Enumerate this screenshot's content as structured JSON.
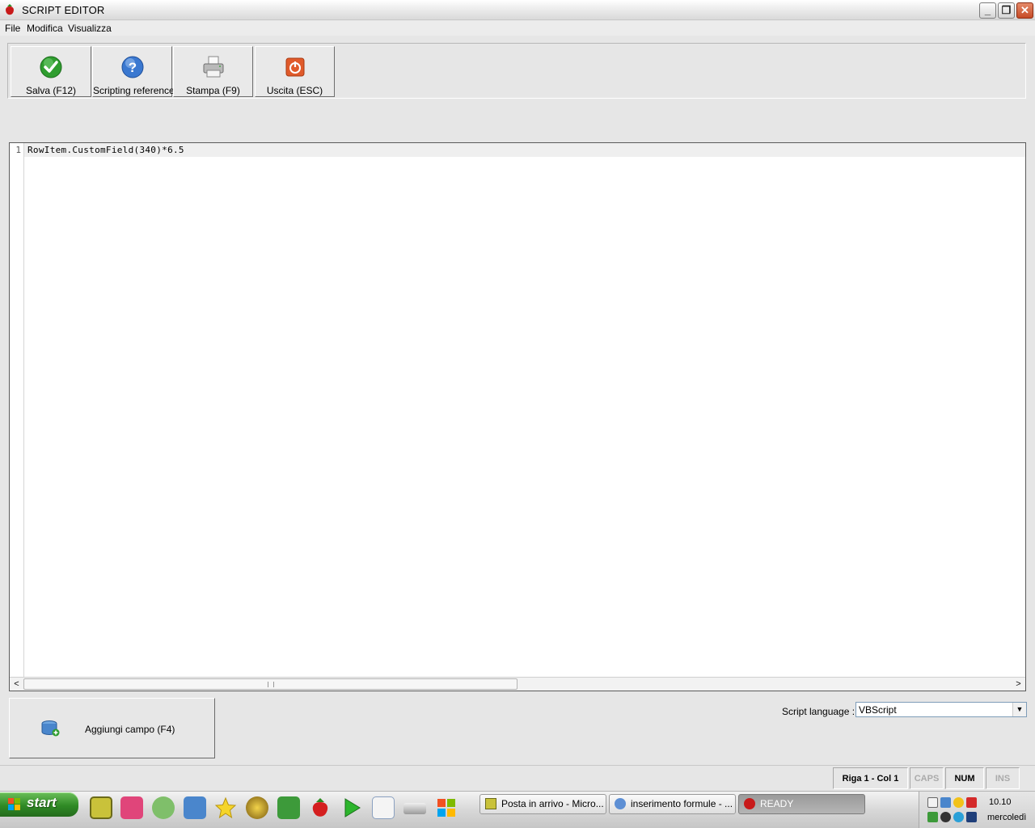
{
  "window": {
    "title": "SCRIPT EDITOR",
    "min": "_",
    "max": "❐",
    "close": "✕"
  },
  "menu": {
    "items": [
      "File",
      "Modifica",
      "Visualizza"
    ]
  },
  "toolbar": {
    "buttons": [
      {
        "label": "Salva (F12)",
        "icon": "save-check-icon"
      },
      {
        "label": "Scripting reference",
        "icon": "help-icon"
      },
      {
        "label": "Stampa (F9)",
        "icon": "printer-icon"
      },
      {
        "label": "Uscita (ESC)",
        "icon": "power-icon"
      }
    ]
  },
  "editor": {
    "line_number": "1",
    "code": "RowItem.CustomField(340)*6.5",
    "scroll_left": "<",
    "scroll_right": ">"
  },
  "add_field": {
    "label": "Aggiungi campo (F4)",
    "icon": "database-add-icon"
  },
  "script_language": {
    "label": "Script language :",
    "value": "VBScript"
  },
  "status": {
    "position": "Riga 1 - Col 1",
    "caps": "CAPS",
    "num": "NUM",
    "ins": "INS"
  },
  "taskbar": {
    "start": "start",
    "quick_launch": [
      "outlook-icon",
      "grid-icon",
      "wheel-icon",
      "refresh-icon",
      "star-icon",
      "button-icon",
      "house-icon",
      "strawberry-icon",
      "play-icon",
      "spreadsheet-icon",
      "drive-icon",
      "windows-icon"
    ],
    "tasks": [
      {
        "label": "Posta in arrivo - Micro...",
        "icon": "outlook-icon"
      },
      {
        "label": "inserimento formule - ...",
        "icon": "browser-icon"
      },
      {
        "label": "READY",
        "icon": "strawberry-icon",
        "active": true
      }
    ],
    "clock": "10.10",
    "day": "mercoledì"
  },
  "colors": {
    "start_green": "#2f8a25",
    "close_red": "#c64b26",
    "editor_bg": "#ffffff",
    "current_line": "#efefef"
  }
}
